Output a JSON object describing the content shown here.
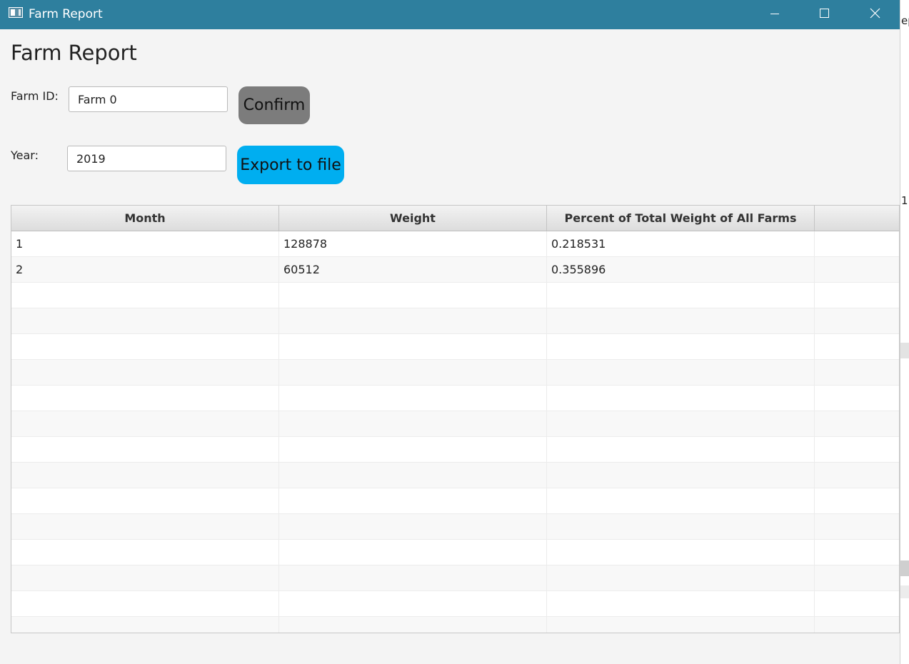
{
  "window": {
    "title": "Farm Report",
    "icon": "app-window-icon",
    "controls": [
      "minimize-icon",
      "maximize-icon",
      "close-icon"
    ]
  },
  "page": {
    "heading": "Farm Report"
  },
  "form": {
    "farm_id_label": "Farm ID:",
    "farm_id_value": "Farm 0",
    "confirm_label": "Confirm",
    "year_label": "Year:",
    "year_value": "2019",
    "export_label": "Export to file"
  },
  "table": {
    "columns": [
      "Month",
      "Weight",
      "Percent of Total Weight of All Farms",
      ""
    ],
    "rows": [
      [
        "1",
        "128878",
        "0.218531",
        ""
      ],
      [
        "2",
        "60512",
        "0.355896",
        ""
      ]
    ],
    "empty_rows": 14
  },
  "background_window": {
    "fragments": [
      "ep",
      "1"
    ]
  },
  "colors": {
    "titlebar": "#2e7f9e",
    "confirm_button": "#7c7c7c",
    "export_button": "#00aef0",
    "window_background": "#f4f4f4"
  }
}
